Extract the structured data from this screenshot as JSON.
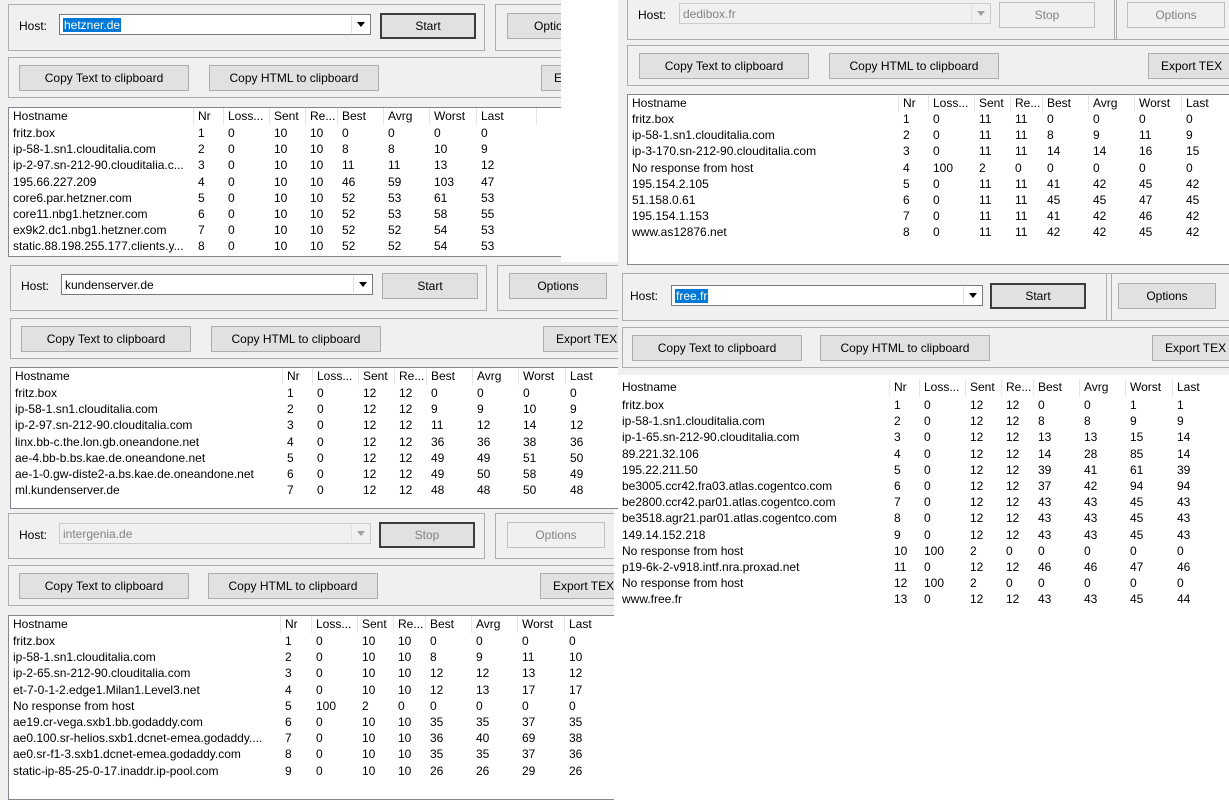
{
  "columns": [
    "Hostname",
    "Nr",
    "Loss...",
    "Sent",
    "Re...",
    "Best",
    "Avrg",
    "Worst",
    "Last"
  ],
  "labels": {
    "host": "Host:",
    "start": "Start",
    "stop": "Stop",
    "options": "Options",
    "options_cut": "Optio",
    "copy_text": "Copy Text to clipboard",
    "copy_html": "Copy HTML to clipboard",
    "export_tex": "Export TEX",
    "export_cut": "E"
  },
  "windows": {
    "hetzner": {
      "host": "hetzner.de",
      "rows": [
        [
          "fritz.box",
          "1",
          "0",
          "10",
          "10",
          "0",
          "0",
          "0",
          "0"
        ],
        [
          "ip-58-1.sn1.clouditalia.com",
          "2",
          "0",
          "10",
          "10",
          "8",
          "8",
          "10",
          "9"
        ],
        [
          "ip-2-97.sn-212-90.clouditalia.c...",
          "3",
          "0",
          "10",
          "10",
          "11",
          "11",
          "13",
          "12"
        ],
        [
          "195.66.227.209",
          "4",
          "0",
          "10",
          "10",
          "46",
          "59",
          "103",
          "47"
        ],
        [
          "core6.par.hetzner.com",
          "5",
          "0",
          "10",
          "10",
          "52",
          "53",
          "61",
          "53"
        ],
        [
          "core11.nbg1.hetzner.com",
          "6",
          "0",
          "10",
          "10",
          "52",
          "53",
          "58",
          "55"
        ],
        [
          "ex9k2.dc1.nbg1.hetzner.com",
          "7",
          "0",
          "10",
          "10",
          "52",
          "52",
          "54",
          "53"
        ],
        [
          "static.88.198.255.177.clients.y...",
          "8",
          "0",
          "10",
          "10",
          "52",
          "52",
          "54",
          "53"
        ]
      ]
    },
    "kunden": {
      "host": "kundenserver.de",
      "rows": [
        [
          "fritz.box",
          "1",
          "0",
          "12",
          "12",
          "0",
          "0",
          "0",
          "0"
        ],
        [
          "ip-58-1.sn1.clouditalia.com",
          "2",
          "0",
          "12",
          "12",
          "9",
          "9",
          "10",
          "9"
        ],
        [
          "ip-2-97.sn-212-90.clouditalia.com",
          "3",
          "0",
          "12",
          "12",
          "11",
          "12",
          "14",
          "12"
        ],
        [
          "linx.bb-c.the.lon.gb.oneandone.net",
          "4",
          "0",
          "12",
          "12",
          "36",
          "36",
          "38",
          "36"
        ],
        [
          "ae-4.bb-b.bs.kae.de.oneandone.net",
          "5",
          "0",
          "12",
          "12",
          "49",
          "49",
          "51",
          "50"
        ],
        [
          "ae-1-0.gw-diste2-a.bs.kae.de.oneandone.net",
          "6",
          "0",
          "12",
          "12",
          "49",
          "50",
          "58",
          "49"
        ],
        [
          "ml.kundenserver.de",
          "7",
          "0",
          "12",
          "12",
          "48",
          "48",
          "50",
          "48"
        ]
      ]
    },
    "intergenia": {
      "host": "intergenia.de",
      "rows": [
        [
          "fritz.box",
          "1",
          "0",
          "10",
          "10",
          "0",
          "0",
          "0",
          "0"
        ],
        [
          "ip-58-1.sn1.clouditalia.com",
          "2",
          "0",
          "10",
          "10",
          "8",
          "9",
          "11",
          "10"
        ],
        [
          "ip-2-65.sn-212-90.clouditalia.com",
          "3",
          "0",
          "10",
          "10",
          "12",
          "12",
          "13",
          "12"
        ],
        [
          "et-7-0-1-2.edge1.Milan1.Level3.net",
          "4",
          "0",
          "10",
          "10",
          "12",
          "13",
          "17",
          "17"
        ],
        [
          "No response from host",
          "5",
          "100",
          "2",
          "0",
          "0",
          "0",
          "0",
          "0"
        ],
        [
          "ae19.cr-vega.sxb1.bb.godaddy.com",
          "6",
          "0",
          "10",
          "10",
          "35",
          "35",
          "37",
          "35"
        ],
        [
          "ae0.100.sr-helios.sxb1.dcnet-emea.godaddy....",
          "7",
          "0",
          "10",
          "10",
          "36",
          "40",
          "69",
          "38"
        ],
        [
          "ae0.sr-f1-3.sxb1.dcnet-emea.godaddy.com",
          "8",
          "0",
          "10",
          "10",
          "35",
          "35",
          "37",
          "36"
        ],
        [
          "static-ip-85-25-0-17.inaddr.ip-pool.com",
          "9",
          "0",
          "10",
          "10",
          "26",
          "26",
          "29",
          "26"
        ]
      ]
    },
    "dedibox": {
      "host": "dedibox.fr",
      "rows": [
        [
          "fritz.box",
          "1",
          "0",
          "11",
          "11",
          "0",
          "0",
          "0",
          "0"
        ],
        [
          "ip-58-1.sn1.clouditalia.com",
          "2",
          "0",
          "11",
          "11",
          "8",
          "9",
          "11",
          "9"
        ],
        [
          "ip-3-170.sn-212-90.clouditalia.com",
          "3",
          "0",
          "11",
          "11",
          "14",
          "14",
          "16",
          "15"
        ],
        [
          "No response from host",
          "4",
          "100",
          "2",
          "0",
          "0",
          "0",
          "0",
          "0"
        ],
        [
          "195.154.2.105",
          "5",
          "0",
          "11",
          "11",
          "41",
          "42",
          "45",
          "42"
        ],
        [
          "51.158.0.61",
          "6",
          "0",
          "11",
          "11",
          "45",
          "45",
          "47",
          "45"
        ],
        [
          "195.154.1.153",
          "7",
          "0",
          "11",
          "11",
          "41",
          "42",
          "46",
          "42"
        ],
        [
          "www.as12876.net",
          "8",
          "0",
          "11",
          "11",
          "42",
          "42",
          "45",
          "42"
        ]
      ]
    },
    "free": {
      "host": "free.fr",
      "rows": [
        [
          "fritz.box",
          "1",
          "0",
          "12",
          "12",
          "0",
          "0",
          "1",
          "1"
        ],
        [
          "ip-58-1.sn1.clouditalia.com",
          "2",
          "0",
          "12",
          "12",
          "8",
          "8",
          "9",
          "9"
        ],
        [
          "ip-1-65.sn-212-90.clouditalia.com",
          "3",
          "0",
          "12",
          "12",
          "13",
          "13",
          "15",
          "14"
        ],
        [
          "89.221.32.106",
          "4",
          "0",
          "12",
          "12",
          "14",
          "28",
          "85",
          "14"
        ],
        [
          "195.22.211.50",
          "5",
          "0",
          "12",
          "12",
          "39",
          "41",
          "61",
          "39"
        ],
        [
          "be3005.ccr42.fra03.atlas.cogentco.com",
          "6",
          "0",
          "12",
          "12",
          "37",
          "42",
          "94",
          "94"
        ],
        [
          "be2800.ccr42.par01.atlas.cogentco.com",
          "7",
          "0",
          "12",
          "12",
          "43",
          "43",
          "45",
          "43"
        ],
        [
          "be3518.agr21.par01.atlas.cogentco.com",
          "8",
          "0",
          "12",
          "12",
          "43",
          "43",
          "45",
          "43"
        ],
        [
          "149.14.152.218",
          "9",
          "0",
          "12",
          "12",
          "43",
          "43",
          "45",
          "43"
        ],
        [
          "No response from host",
          "10",
          "100",
          "2",
          "0",
          "0",
          "0",
          "0",
          "0"
        ],
        [
          "p19-6k-2-v918.intf.nra.proxad.net",
          "11",
          "0",
          "12",
          "12",
          "46",
          "46",
          "47",
          "46"
        ],
        [
          "No response from host",
          "12",
          "100",
          "2",
          "0",
          "0",
          "0",
          "0",
          "0"
        ],
        [
          "www.free.fr",
          "13",
          "0",
          "12",
          "12",
          "43",
          "43",
          "45",
          "44"
        ]
      ]
    }
  }
}
